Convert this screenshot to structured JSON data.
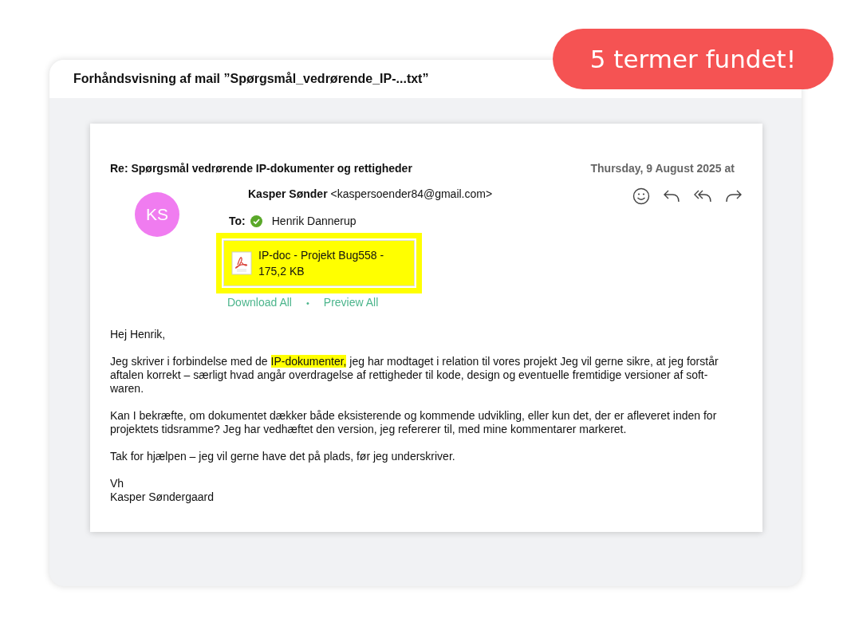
{
  "badge": {
    "text": "5 termer fundet!"
  },
  "window": {
    "title": "Forhåndsvisning af mail ”Spørgsmål_vedrørende_IP-...txt”"
  },
  "email": {
    "subject": "Re: Spørgsmål vedrørende IP-dokumenter og rettigheder",
    "date": "Thursday, 9 August 2025 at",
    "avatar": {
      "initials": "KS",
      "color": "#f07cf0"
    },
    "sender_name": "Kasper Sønder",
    "sender_address": "<kaspersoender84@gmail.com>",
    "to_label": "To:",
    "to_verified": true,
    "recipient": "Henrik Dannerup",
    "attachment": {
      "name": "IP-doc - Projekt Bug558 - 175,2 KB",
      "highlighted": true
    },
    "links": [
      "Download All",
      "Preview All"
    ],
    "separator": "•",
    "paragraphs": [
      [
        {
          "text": "Hej Henrik,",
          "highlighted": false
        }
      ],
      [
        {
          "text": "Jeg skriver i forbindelse med de ",
          "highlighted": false
        },
        {
          "text": "IP-dokumenter,",
          "highlighted": true
        },
        {
          "text": " jeg har modtaget i relation til vores projekt Jeg vil gerne sikre, at jeg forstår aftalen korrekt – særligt hvad angår overdragelse af rettigheder til kode, design og eventuelle fremtidige versioner af soft-waren.",
          "highlighted": false
        }
      ],
      [
        {
          "text": "Kan I bekræfte, om dokumentet dækker både eksisterende og kommende udvikling, eller kun det, der er afleveret inden for projektets tidsramme? Jeg har vedhæftet den version, jeg refererer til, med mine kommentarer markeret.",
          "highlighted": false
        }
      ],
      [
        {
          "text": "Tak for hjælpen – jeg vil gerne have det på plads, før jeg underskriver.",
          "highlighted": false
        }
      ],
      [
        {
          "text": "Vh",
          "highlighted": false
        }
      ],
      [
        {
          "text": "Kasper Søndergaard",
          "highlighted": false
        }
      ]
    ]
  }
}
